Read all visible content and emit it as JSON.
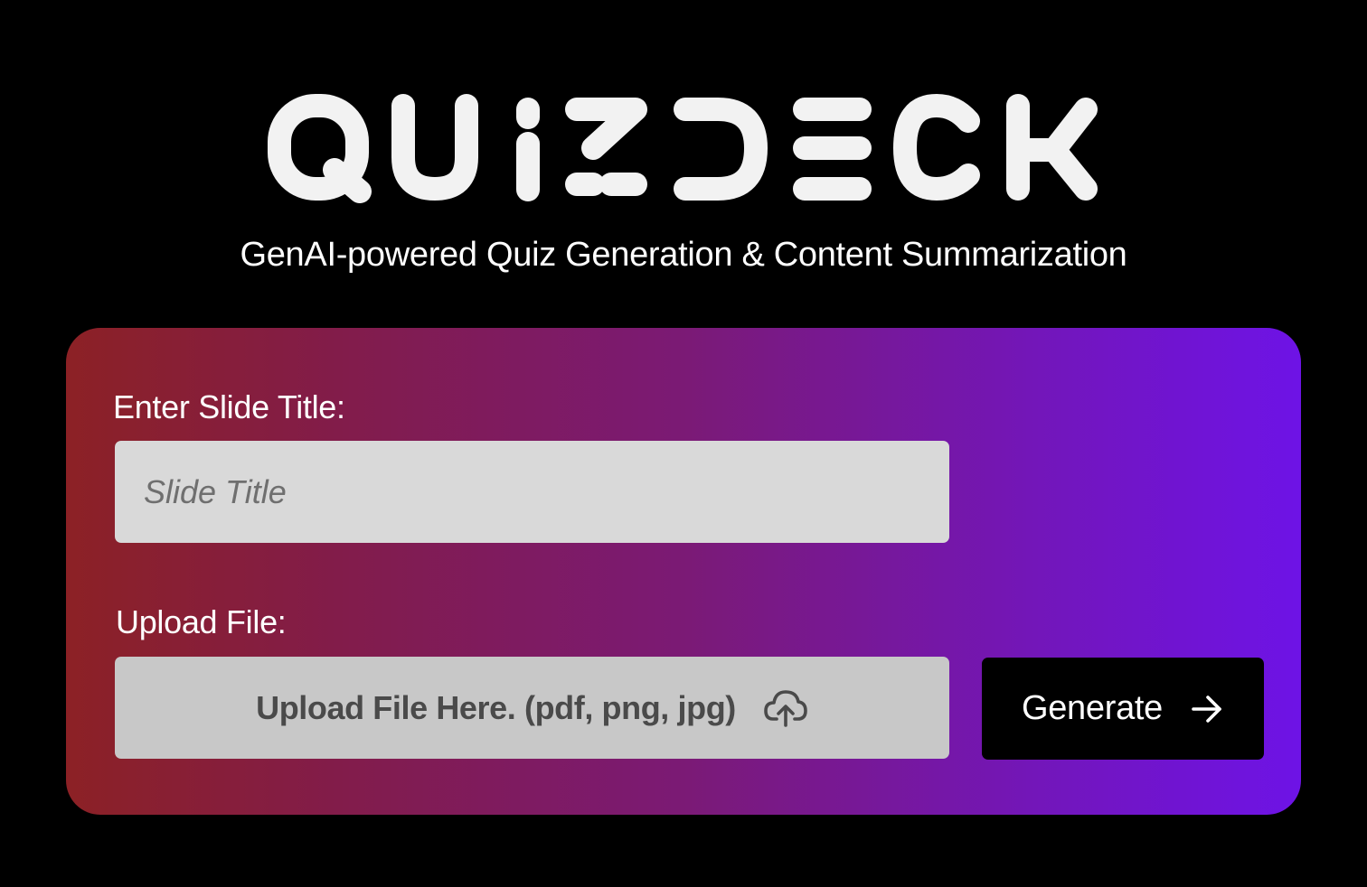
{
  "app": {
    "logo_text": "QUIZDECK",
    "subtitle": "GenAI-powered Quiz Generation & Content Summarization"
  },
  "form": {
    "title_label": "Enter Slide Title:",
    "title_placeholder": "Slide Title",
    "title_value": "",
    "upload_label": "Upload File:",
    "upload_prompt": "Upload File Here. (pdf, png, jpg)",
    "upload_icon": "cloud-upload-icon",
    "generate_label": "Generate",
    "generate_icon": "arrow-right-icon"
  },
  "colors": {
    "background": "#000000",
    "card_gradient_start": "#8c2125",
    "card_gradient_end": "#6e13e6",
    "input_background": "#d9d9d9",
    "upload_background": "#c8c8c8",
    "button_background": "#000000",
    "text_primary": "#ffffff"
  }
}
